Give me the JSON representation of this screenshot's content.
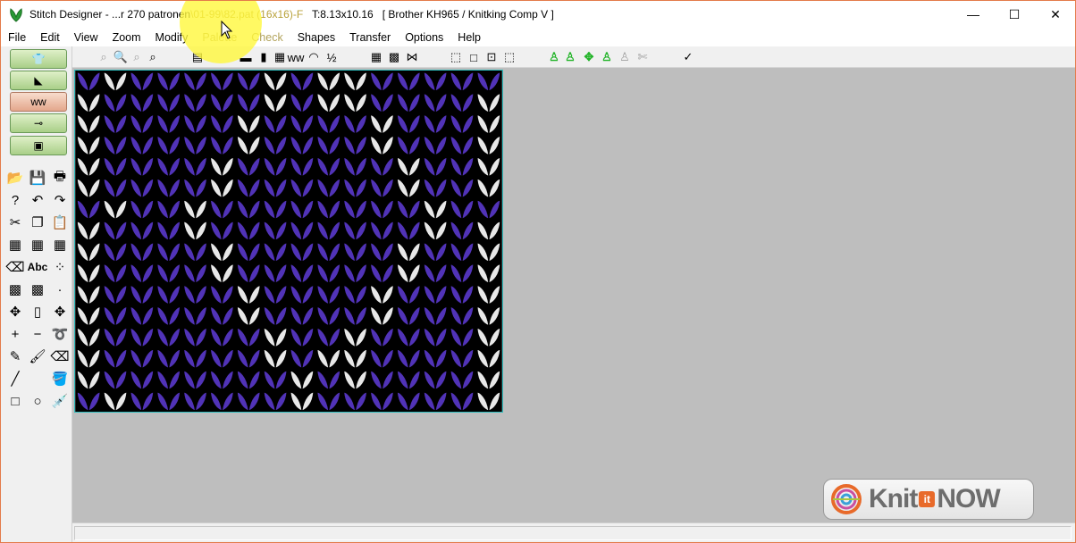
{
  "window": {
    "title_prefix": "Stitch Designer - ...r 270 patronen",
    "title_file": "\\01-99\\82.pat (16x16)-F",
    "title_tension": "T:8.13x10.16",
    "title_machine": "[ Brother KH965 / Knitking Comp V ]",
    "minimize_glyph": "—",
    "maximize_glyph": "☐",
    "close_glyph": "✕"
  },
  "menu": [
    {
      "label": "File",
      "dim": false
    },
    {
      "label": "Edit",
      "dim": false
    },
    {
      "label": "View",
      "dim": false
    },
    {
      "label": "Zoom",
      "dim": false
    },
    {
      "label": "Modify",
      "dim": false
    },
    {
      "label": "Palette",
      "dim": true
    },
    {
      "label": "Check",
      "dim": true
    },
    {
      "label": "Shapes",
      "dim": false
    },
    {
      "label": "Transfer",
      "dim": false
    },
    {
      "label": "Options",
      "dim": false
    },
    {
      "label": "Help",
      "dim": false
    }
  ],
  "toolbar": [
    {
      "name": "zoom-out-icon",
      "glyph": "⌕",
      "style": "gray"
    },
    {
      "name": "zoom-in-icon",
      "glyph": "🔍",
      "style": "normal"
    },
    {
      "name": "zoom-fit-icon",
      "glyph": "⌕",
      "style": "gray"
    },
    {
      "name": "zoom-window-icon",
      "glyph": "⌕",
      "style": "normal"
    },
    {
      "name": "ruler-icon",
      "glyph": "▤",
      "style": "normal"
    },
    {
      "name": "horizontal-ruler-icon",
      "glyph": "▬",
      "style": "normal"
    },
    {
      "name": "vertical-ruler-icon",
      "glyph": "▮",
      "style": "normal"
    },
    {
      "name": "grid-icon",
      "glyph": "▦",
      "style": "normal"
    },
    {
      "name": "stitch-view-icon",
      "glyph": "ww",
      "style": "normal"
    },
    {
      "name": "palette-rainbow-icon",
      "glyph": "◠",
      "style": "normal"
    },
    {
      "name": "numbering-icon",
      "glyph": "½",
      "style": "normal"
    },
    {
      "name": "color-grid-icon",
      "glyph": "▦",
      "style": "normal"
    },
    {
      "name": "pattern-grid-icon",
      "glyph": "▩",
      "style": "normal"
    },
    {
      "name": "cable-icon",
      "glyph": "⋈",
      "style": "normal"
    },
    {
      "name": "select-lasso-icon",
      "glyph": "⬚",
      "style": "normal"
    },
    {
      "name": "select-rect-icon",
      "glyph": "□",
      "style": "normal"
    },
    {
      "name": "select-points-icon",
      "glyph": "⊡",
      "style": "normal"
    },
    {
      "name": "select-corner-icon",
      "glyph": "⬚",
      "style": "normal"
    },
    {
      "name": "garment-front-icon",
      "glyph": "♙",
      "style": "green"
    },
    {
      "name": "garment-back-icon",
      "glyph": "♙",
      "style": "green"
    },
    {
      "name": "garment-move-icon",
      "glyph": "✥",
      "style": "green"
    },
    {
      "name": "garment-sleeve-icon",
      "glyph": "♙",
      "style": "green"
    },
    {
      "name": "garment-gray-icon",
      "glyph": "♙",
      "style": "gray"
    },
    {
      "name": "garment-cut-icon",
      "glyph": "✄",
      "style": "gray"
    },
    {
      "name": "checkmark-icon",
      "glyph": "✓",
      "style": "normal"
    }
  ],
  "left_modes": [
    {
      "name": "garment-mode-button",
      "glyph": "👕",
      "style": "green"
    },
    {
      "name": "chart-mode-button",
      "glyph": "◣",
      "style": "green"
    },
    {
      "name": "stitch-mode-button",
      "glyph": "ww",
      "style": "pink"
    },
    {
      "name": "needle-mode-button",
      "glyph": "⊸",
      "style": "green"
    },
    {
      "name": "screen-mode-button",
      "glyph": "▣",
      "style": "green"
    }
  ],
  "left_tools": [
    {
      "name": "open-folder-icon",
      "glyph": "📂",
      "col": 0,
      "row": 0
    },
    {
      "name": "save-icon",
      "glyph": "💾",
      "col": 1,
      "row": 0
    },
    {
      "name": "print-icon",
      "glyph": "🖶",
      "col": 2,
      "row": 0
    },
    {
      "name": "help-icon",
      "glyph": "?",
      "col": 0,
      "row": 1
    },
    {
      "name": "undo-icon",
      "glyph": "↶",
      "col": 1,
      "row": 1
    },
    {
      "name": "redo-icon",
      "glyph": "↷",
      "col": 2,
      "row": 1
    },
    {
      "name": "scissors-icon",
      "glyph": "✂",
      "col": 0,
      "row": 2
    },
    {
      "name": "copy-icon",
      "glyph": "❐",
      "col": 1,
      "row": 2
    },
    {
      "name": "paste-icon",
      "glyph": "📋",
      "col": 2,
      "row": 2
    },
    {
      "name": "grid-a-icon",
      "glyph": "▦",
      "col": 0,
      "row": 3
    },
    {
      "name": "grid-b-icon",
      "glyph": "▦",
      "col": 1,
      "row": 3
    },
    {
      "name": "grid-c-icon",
      "glyph": "▦",
      "col": 2,
      "row": 3
    },
    {
      "name": "eraser-icon",
      "glyph": "⌫",
      "col": 0,
      "row": 4
    },
    {
      "name": "text-tool-label",
      "glyph": "Abc",
      "col": 1,
      "row": 4
    },
    {
      "name": "dots-icon",
      "glyph": "⁘",
      "col": 2,
      "row": 4
    },
    {
      "name": "checker-a-icon",
      "glyph": "▩",
      "col": 0,
      "row": 5
    },
    {
      "name": "checker-b-icon",
      "glyph": "▩",
      "col": 1,
      "row": 5
    },
    {
      "name": "single-dot-icon",
      "glyph": "·",
      "col": 2,
      "row": 5
    },
    {
      "name": "move-icon",
      "glyph": "✥",
      "col": 0,
      "row": 6
    },
    {
      "name": "page-icon",
      "glyph": "▯",
      "col": 1,
      "row": 6
    },
    {
      "name": "move-gray-icon",
      "glyph": "✥",
      "col": 2,
      "row": 6
    },
    {
      "name": "plus-icon",
      "glyph": "+",
      "col": 0,
      "row": 7
    },
    {
      "name": "minus-icon",
      "glyph": "−",
      "col": 1,
      "row": 7
    },
    {
      "name": "lasso-icon",
      "glyph": "➰",
      "col": 2,
      "row": 7
    },
    {
      "name": "pencil-icon",
      "glyph": "✎",
      "col": 0,
      "row": 8
    },
    {
      "name": "brush-icon",
      "glyph": "🖌",
      "col": 1,
      "row": 8
    },
    {
      "name": "eraser-green-icon",
      "glyph": "⌫",
      "col": 2,
      "row": 8
    },
    {
      "name": "line-icon",
      "glyph": "╱",
      "col": 0,
      "row": 9
    },
    {
      "name": "fill-bucket-icon",
      "glyph": "🪣",
      "col": 2,
      "row": 9
    },
    {
      "name": "rectangle-icon",
      "glyph": "□",
      "col": 0,
      "row": 10
    },
    {
      "name": "circle-icon",
      "glyph": "○",
      "col": 1,
      "row": 10
    },
    {
      "name": "eyedropper-icon",
      "glyph": "💉",
      "col": 2,
      "row": 10
    }
  ],
  "pattern": {
    "colors": {
      "main": "#5133b8",
      "contrast": "#e8e8e8",
      "background": "#000000"
    },
    "rows": [
      "0100000101100000",
      "1000000101100001",
      "1000001000010001",
      "1000001000010001",
      "1000010000001001",
      "1000010000001001",
      "0100100000000100",
      "1000100000000101",
      "1000010000001001",
      "1000010000001001",
      "1000001000010001",
      "1000001000010001",
      "1000000100100001",
      "1000000101100001",
      "1000000010100001",
      "0100000010000001"
    ]
  },
  "logo": {
    "knit": "Knit",
    "it": "it",
    "now": "NOW"
  }
}
